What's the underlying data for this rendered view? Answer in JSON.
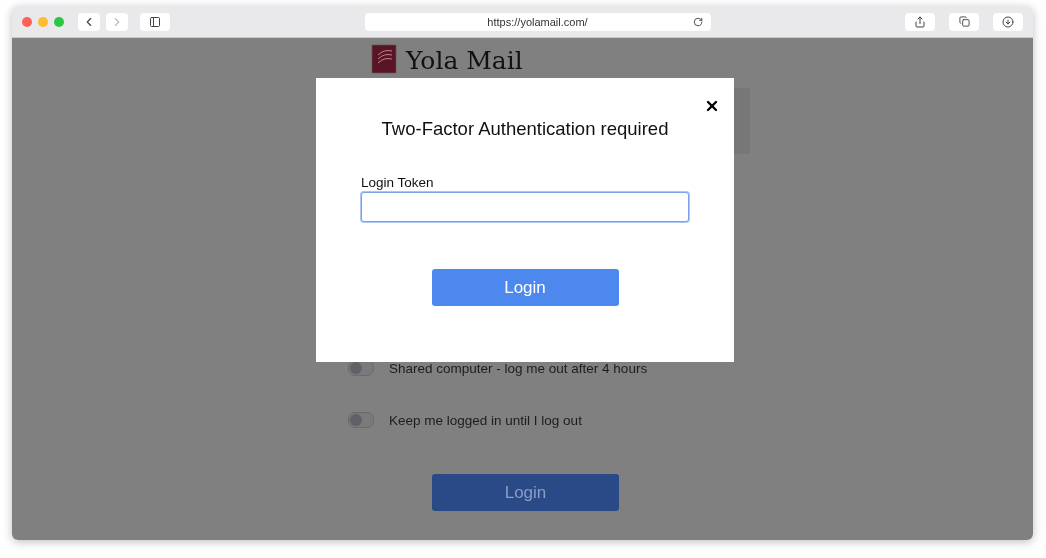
{
  "browser": {
    "url": "https://yolamail.com/"
  },
  "page": {
    "logo": "Yola Mail",
    "options": [
      {
        "label": "Shared computer - log me out after 4 hours",
        "on": false
      },
      {
        "label": "Keep me logged in until I log out",
        "on": false
      }
    ],
    "button": "Login"
  },
  "modal": {
    "title": "Two-Factor Authentication required",
    "field_label": "Login Token",
    "button": "Login"
  }
}
